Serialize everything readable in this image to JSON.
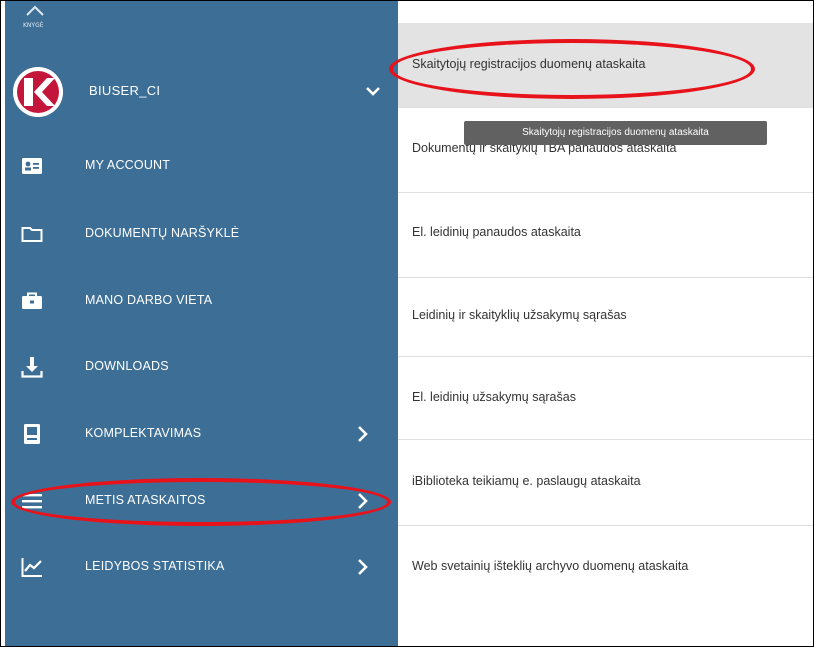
{
  "sidebar": {
    "logo_text": "KNYGĖ",
    "user": {
      "name": "BIUSER_CI"
    },
    "items": [
      {
        "label": "MY ACCOUNT",
        "icon": "account-card-icon",
        "has_arrow": false
      },
      {
        "label": "DOKUMENTŲ NARŠYKLĖ",
        "icon": "folder-icon",
        "has_arrow": false
      },
      {
        "label": "MANO DARBO VIETA",
        "icon": "briefcase-icon",
        "has_arrow": false
      },
      {
        "label": "DOWNLOADS",
        "icon": "download-icon",
        "has_arrow": false
      },
      {
        "label": "KOMPLEKTAVIMAS",
        "icon": "book-icon",
        "has_arrow": true
      },
      {
        "label": "METIS ATASKAITOS",
        "icon": "list-icon",
        "has_arrow": true
      },
      {
        "label": "LEIDYBOS STATISTIKA",
        "icon": "chart-icon",
        "has_arrow": true
      }
    ]
  },
  "reports": [
    "Skaitytojų registracijos duomenų ataskaita",
    "Dokumentų ir skaityklų TBA panaudos ataskaita",
    "El. leidinių panaudos ataskaita",
    "Leidinių ir skaityklių užsakymų sąrašas",
    "El. leidinių užsakymų sąrašas",
    "iBiblioteka teikiamų e. paslaugų ataskaita",
    "Web svetainių išteklių archyvo duomenų ataskaita"
  ],
  "tooltip": "Skaitytojų registracijos duomenų ataskaita",
  "colors": {
    "sidebar": "#3d6e96",
    "highlight": "#e8121b",
    "selected_row": "#e3e3e3"
  }
}
